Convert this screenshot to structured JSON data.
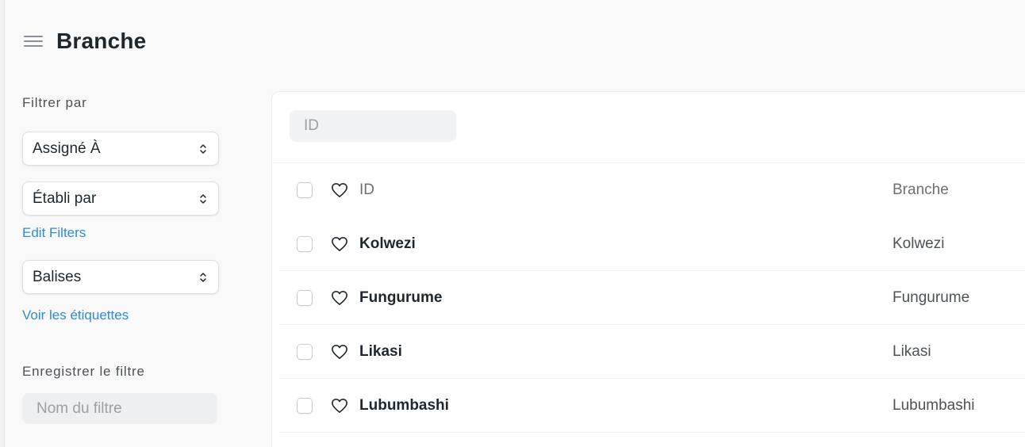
{
  "header": {
    "title": "Branche",
    "menu_icon": "hamburger-menu-icon"
  },
  "sidebar": {
    "filter_label": "Filtrer par",
    "filters": [
      {
        "label": "Assigné À"
      },
      {
        "label": "Établi par"
      }
    ],
    "edit_filters": "Edit Filters",
    "tags_select": "Balises",
    "show_tags": "Voir les étiquettes",
    "save_filter_label": "Enregistrer le filtre",
    "filter_name_placeholder": "Nom du filtre"
  },
  "list": {
    "search_placeholder": "ID",
    "columns": {
      "id": "ID",
      "branch": "Branche"
    },
    "rows": [
      {
        "id": "Kolwezi",
        "branch": "Kolwezi"
      },
      {
        "id": "Fungurume",
        "branch": "Fungurume"
      },
      {
        "id": "Likasi",
        "branch": "Likasi"
      },
      {
        "id": "Lubumbashi",
        "branch": "Lubumbashi"
      }
    ]
  },
  "colors": {
    "accent": "#2f8ad9",
    "text": "#1f272e",
    "muted": "#6a7075",
    "background": "#f9f9f9"
  }
}
